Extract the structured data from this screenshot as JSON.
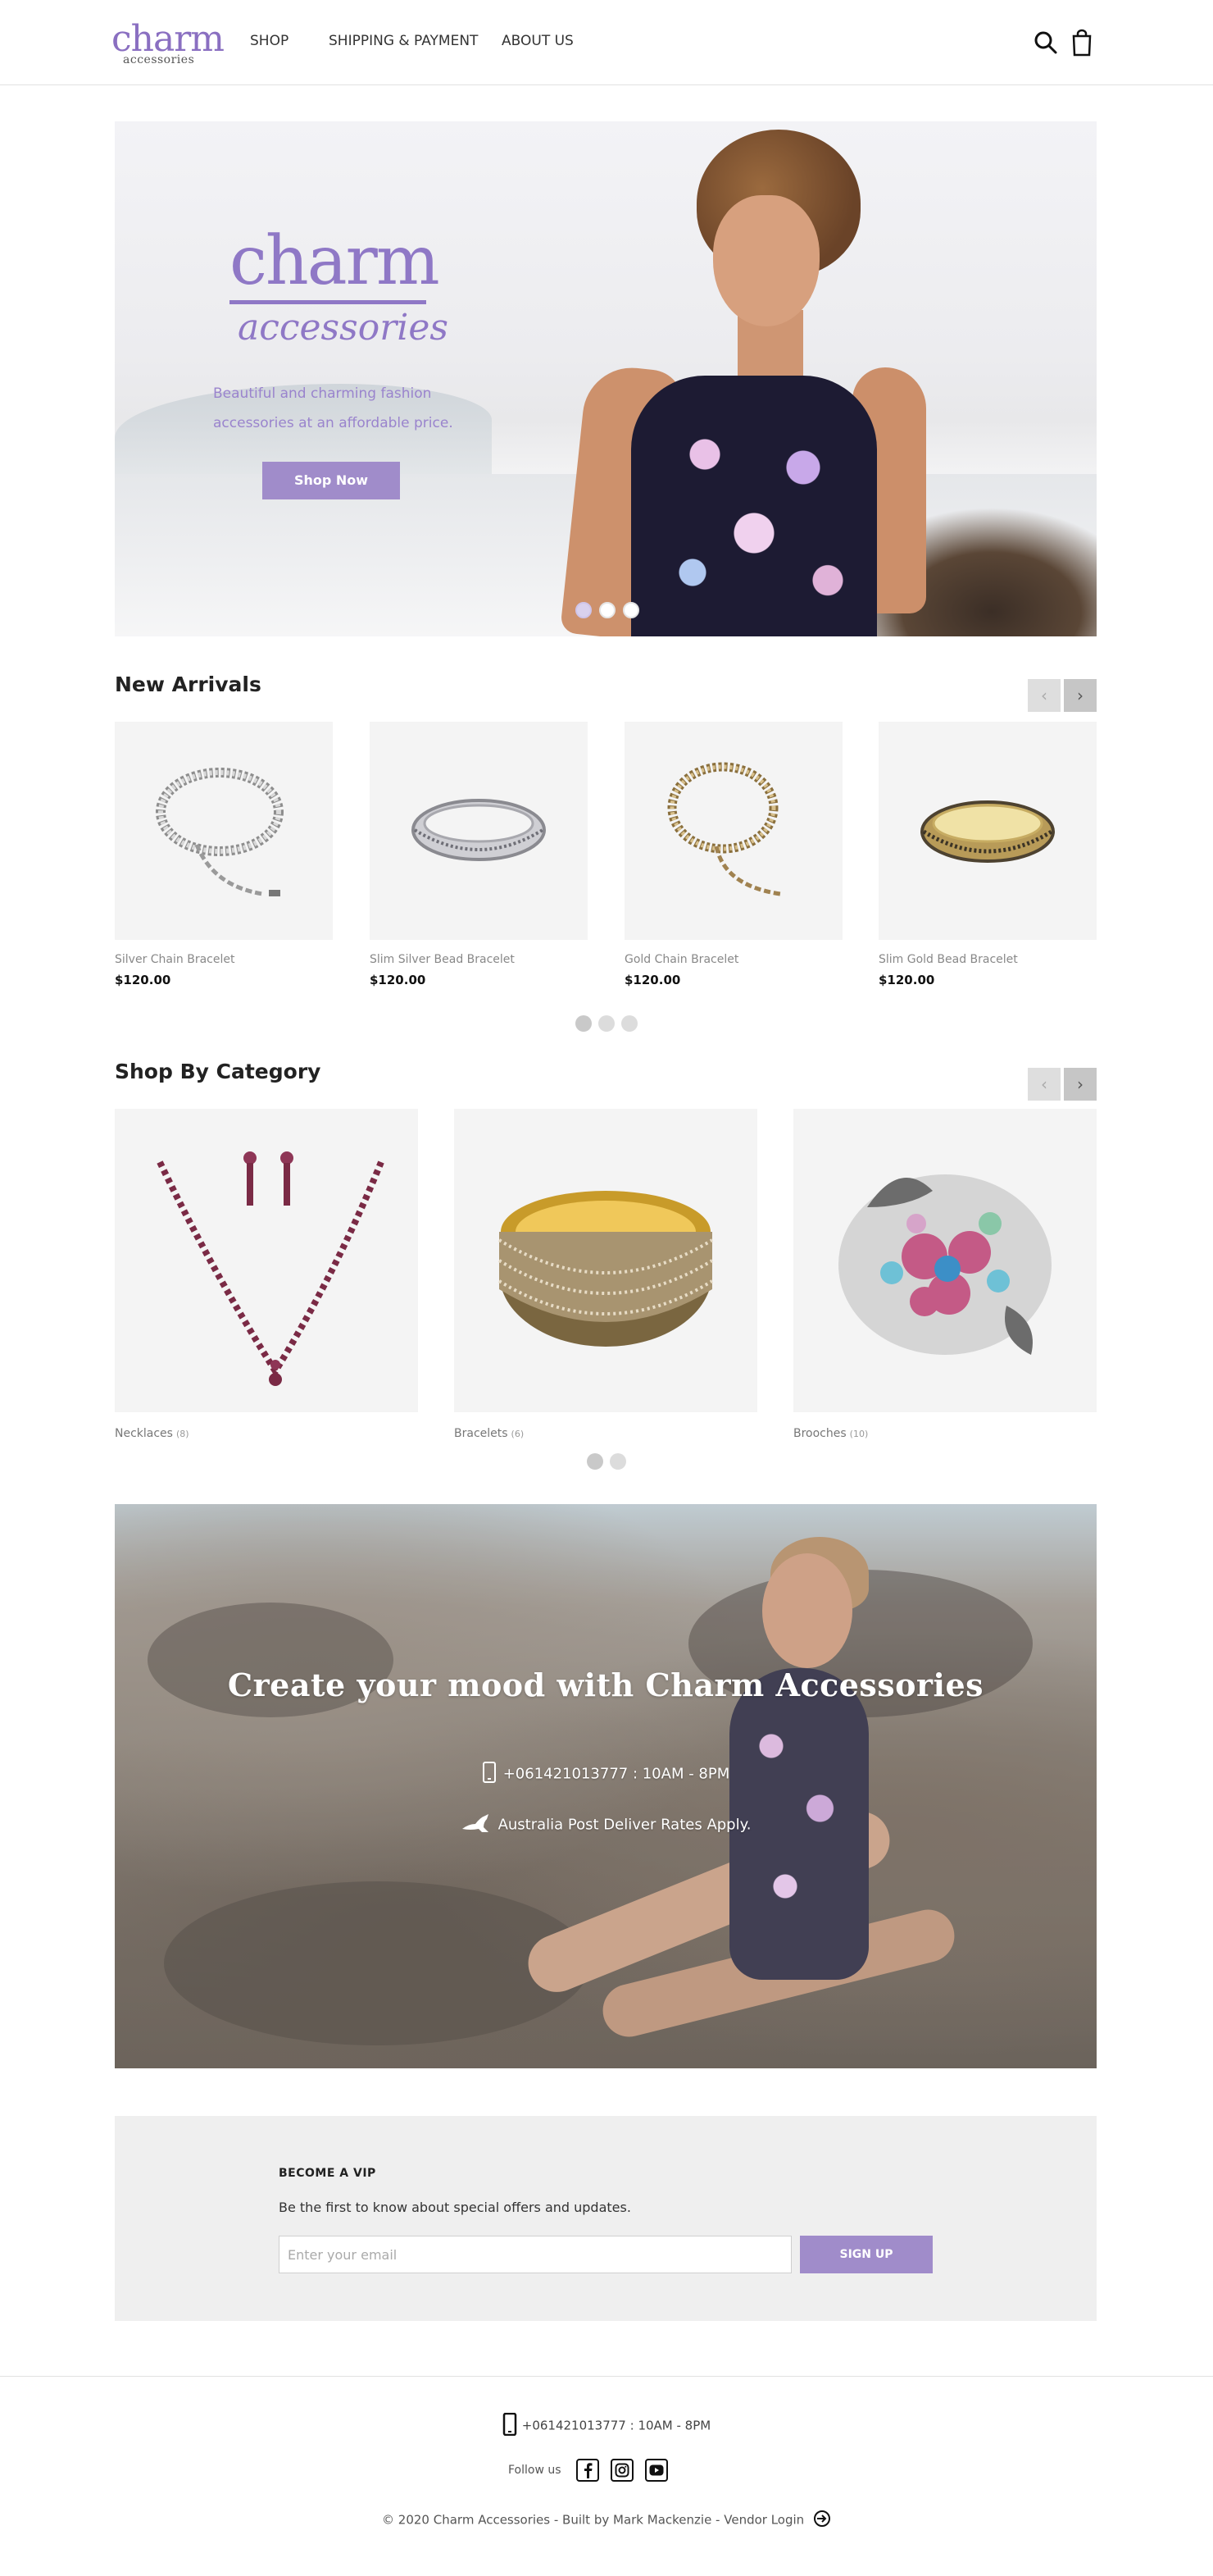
{
  "brand": {
    "name": "charm",
    "sub": "accessories"
  },
  "nav": {
    "shop": "SHOP",
    "shipping": "SHIPPING & PAYMENT",
    "about": "ABOUT US"
  },
  "header_icons": [
    "search-icon",
    "shopping-bag-icon"
  ],
  "hero": {
    "brand_main": "charm",
    "brand_sub": "accessories",
    "tagline_1": "Beautiful and charming fashion",
    "tagline_2": "accessories at an affordable price.",
    "cta": "Shop Now",
    "slides": 3,
    "active_slide": 1
  },
  "new_arrivals": {
    "title": "New Arrivals",
    "products": [
      {
        "name": "Silver Chain Bracelet",
        "price": "$120.00"
      },
      {
        "name": "Slim Silver Bead Bracelet",
        "price": "$120.00"
      },
      {
        "name": "Gold Chain Bracelet",
        "price": "$120.00"
      },
      {
        "name": "Slim Gold Bead Bracelet",
        "price": "$120.00"
      }
    ],
    "pages": 3,
    "active_page": 1
  },
  "categories": {
    "title": "Shop By Category",
    "items": [
      {
        "name": "Necklaces",
        "count": "(8)"
      },
      {
        "name": "Bracelets",
        "count": "(6)"
      },
      {
        "name": "Brooches",
        "count": "(10)"
      }
    ],
    "pages": 2,
    "active_page": 1
  },
  "mood": {
    "title": "Create your mood with Charm Accessories",
    "phone": "+061421013777 : 10AM - 8PM",
    "shipping": "Australia Post Deliver Rates Apply."
  },
  "vip": {
    "title": "BECOME A VIP",
    "subtitle": "Be the first to know about special offers and updates.",
    "placeholder": "Enter your email",
    "button": "SIGN UP"
  },
  "footer": {
    "phone": "+061421013777 : 10AM - 8PM",
    "follow": "Follow us",
    "social": [
      "facebook-icon",
      "instagram-icon",
      "youtube-icon"
    ],
    "copyright": "© 2020 Charm Accessories - Built by Mark Mackenzie - ",
    "vendor_login": "Vendor Login"
  },
  "colors": {
    "accent": "#a08cca",
    "brand": "#8a6fc1",
    "panel": "#efefef"
  }
}
